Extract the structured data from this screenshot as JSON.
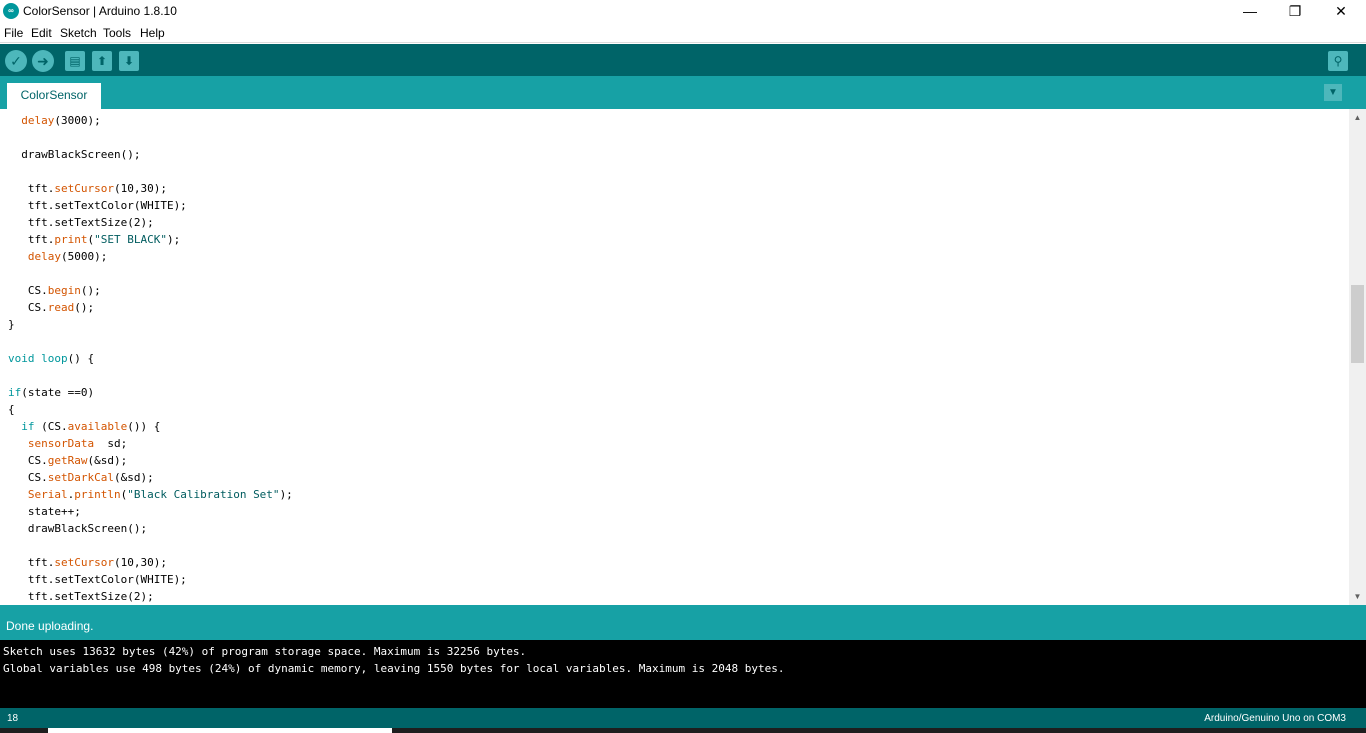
{
  "window": {
    "title": "ColorSensor | Arduino 1.8.10",
    "logo_text": "∞",
    "minimize": "—",
    "restore": "❐",
    "close": "✕"
  },
  "menu": [
    "File",
    "Edit",
    "Sketch",
    "Tools",
    "Help"
  ],
  "toolbar": {
    "verify_icon": "✓",
    "upload_icon": "➜",
    "new_icon": "▤",
    "open_icon": "⬆",
    "save_icon": "⬇",
    "serial_monitor_icon": "⚲"
  },
  "tabs": [
    {
      "label": "ColorSensor"
    }
  ],
  "tab_menu_icon": "▼",
  "code_lines": [
    [
      {
        "t": "  "
      },
      {
        "t": "delay",
        "c": "fn"
      },
      {
        "t": "(3000);"
      }
    ],
    [
      {
        "t": ""
      }
    ],
    [
      {
        "t": "  drawBlackScreen();"
      }
    ],
    [
      {
        "t": ""
      }
    ],
    [
      {
        "t": "   tft."
      },
      {
        "t": "setCursor",
        "c": "fn"
      },
      {
        "t": "(10,30);"
      }
    ],
    [
      {
        "t": "   tft.setTextColor(WHITE);"
      }
    ],
    [
      {
        "t": "   tft.setTextSize(2);"
      }
    ],
    [
      {
        "t": "   tft."
      },
      {
        "t": "print",
        "c": "fn"
      },
      {
        "t": "("
      },
      {
        "t": "\"SET BLACK\"",
        "c": "str"
      },
      {
        "t": ");"
      }
    ],
    [
      {
        "t": "   "
      },
      {
        "t": "delay",
        "c": "fn"
      },
      {
        "t": "(5000);"
      }
    ],
    [
      {
        "t": ""
      }
    ],
    [
      {
        "t": "   CS."
      },
      {
        "t": "begin",
        "c": "fn"
      },
      {
        "t": "();"
      }
    ],
    [
      {
        "t": "   CS."
      },
      {
        "t": "read",
        "c": "fn"
      },
      {
        "t": "();"
      }
    ],
    [
      {
        "t": "}"
      }
    ],
    [
      {
        "t": ""
      }
    ],
    [
      {
        "t": "void",
        "c": "kw"
      },
      {
        "t": " "
      },
      {
        "t": "loop",
        "c": "kw"
      },
      {
        "t": "() {"
      }
    ],
    [
      {
        "t": ""
      }
    ],
    [
      {
        "t": "if",
        "c": "kw"
      },
      {
        "t": "(state ==0)"
      }
    ],
    [
      {
        "t": "{"
      }
    ],
    [
      {
        "t": "  "
      },
      {
        "t": "if",
        "c": "kw"
      },
      {
        "t": " (CS."
      },
      {
        "t": "available",
        "c": "fn"
      },
      {
        "t": "()) {"
      }
    ],
    [
      {
        "t": "   "
      },
      {
        "t": "sensorData",
        "c": "fn"
      },
      {
        "t": "  sd;"
      }
    ],
    [
      {
        "t": "   CS."
      },
      {
        "t": "getRaw",
        "c": "fn"
      },
      {
        "t": "(&sd);"
      }
    ],
    [
      {
        "t": "   CS."
      },
      {
        "t": "setDarkCal",
        "c": "fn"
      },
      {
        "t": "(&sd);"
      }
    ],
    [
      {
        "t": "   "
      },
      {
        "t": "Serial",
        "c": "fn"
      },
      {
        "t": "."
      },
      {
        "t": "println",
        "c": "fn"
      },
      {
        "t": "("
      },
      {
        "t": "\"Black Calibration Set\"",
        "c": "str"
      },
      {
        "t": ");"
      }
    ],
    [
      {
        "t": "   state++;"
      }
    ],
    [
      {
        "t": "   drawBlackScreen();"
      }
    ],
    [
      {
        "t": ""
      }
    ],
    [
      {
        "t": "   tft."
      },
      {
        "t": "setCursor",
        "c": "fn"
      },
      {
        "t": "(10,30);"
      }
    ],
    [
      {
        "t": "   tft.setTextColor(WHITE);"
      }
    ],
    [
      {
        "t": "   tft.setTextSize(2);"
      }
    ]
  ],
  "status": {
    "message": "Done uploading."
  },
  "console": [
    "Sketch uses 13632 bytes (42%) of program storage space. Maximum is 32256 bytes.",
    "Global variables use 498 bytes (24%) of dynamic memory, leaving 1550 bytes for local variables. Maximum is 2048 bytes."
  ],
  "footer": {
    "line": "18",
    "board": "Arduino/Genuino Uno on COM3"
  },
  "scroll": {
    "up_icon": "▲",
    "down_icon": "▼"
  },
  "colors": {
    "toolbar": "#006468",
    "tabbar": "#17a1a5",
    "keyword": "#00979c",
    "function": "#d35400"
  }
}
